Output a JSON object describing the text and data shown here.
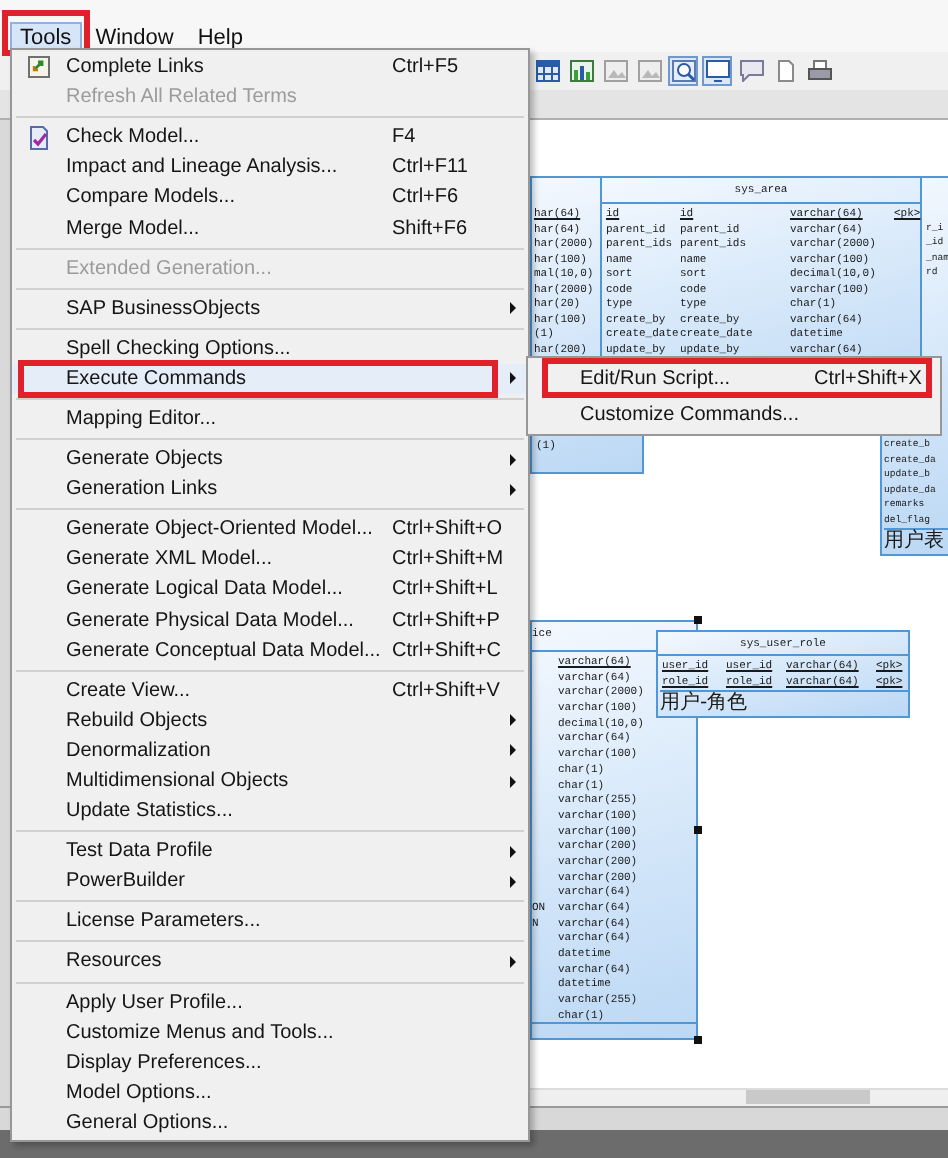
{
  "menu_bar": [
    {
      "label": "Tools",
      "selected": true,
      "outlined": true
    },
    {
      "label": "Window",
      "selected": false,
      "outlined": false
    },
    {
      "label": "Help",
      "selected": false,
      "outlined": false
    }
  ],
  "toolbar": [
    {
      "kind": "table",
      "pressed": false
    },
    {
      "kind": "chart",
      "pressed": false
    },
    {
      "kind": "image",
      "pressed": false
    },
    {
      "kind": "image",
      "pressed": false
    },
    {
      "kind": "zoom",
      "pressed": true
    },
    {
      "kind": "monitor",
      "pressed": true
    },
    {
      "kind": "comment",
      "pressed": false
    },
    {
      "kind": "page",
      "pressed": false
    },
    {
      "kind": "printer",
      "pressed": false
    }
  ],
  "tools_menu": [
    {
      "kind": "links",
      "label": "Complete Links",
      "shortcut": "Ctrl+F5",
      "disabled": false,
      "submenu": false,
      "selected": false,
      "outlined": false
    },
    {
      "kind": "item",
      "label": "Refresh All Related Terms",
      "disabled": true,
      "submenu": false,
      "selected": false,
      "outlined": false
    },
    {
      "kind": "separator"
    },
    {
      "kind": "check",
      "label": "Check Model...",
      "shortcut": "F4",
      "disabled": false,
      "submenu": false,
      "selected": false,
      "outlined": false
    },
    {
      "kind": "item",
      "label": "Impact and Lineage Analysis...",
      "shortcut": "Ctrl+F11",
      "disabled": false,
      "submenu": false,
      "selected": false,
      "outlined": false
    },
    {
      "kind": "item",
      "label": "Compare Models...",
      "shortcut": "Ctrl+F6",
      "disabled": false,
      "submenu": false,
      "selected": false,
      "outlined": false
    },
    {
      "kind": "item",
      "label": "Merge Model...",
      "shortcut": "Shift+F6",
      "disabled": false,
      "submenu": false,
      "selected": false,
      "outlined": false
    },
    {
      "kind": "separator"
    },
    {
      "kind": "item",
      "label": "Extended Generation...",
      "disabled": true,
      "submenu": false,
      "selected": false,
      "outlined": false
    },
    {
      "kind": "separator"
    },
    {
      "kind": "item",
      "label": "SAP BusinessObjects",
      "disabled": false,
      "submenu": true,
      "selected": false,
      "outlined": false
    },
    {
      "kind": "separator"
    },
    {
      "kind": "item",
      "label": "Spell Checking Options...",
      "disabled": false,
      "submenu": false,
      "selected": false,
      "outlined": false
    },
    {
      "kind": "item",
      "label": "Execute Commands",
      "disabled": false,
      "submenu": true,
      "selected": true,
      "outlined": true
    },
    {
      "kind": "separator"
    },
    {
      "kind": "item",
      "label": "Mapping Editor...",
      "disabled": false,
      "submenu": false,
      "selected": false,
      "outlined": false
    },
    {
      "kind": "separator"
    },
    {
      "kind": "item",
      "label": "Generate Objects",
      "disabled": false,
      "submenu": true,
      "selected": false,
      "outlined": false
    },
    {
      "kind": "item",
      "label": "Generation Links",
      "disabled": false,
      "submenu": true,
      "selected": false,
      "outlined": false
    },
    {
      "kind": "separator"
    },
    {
      "kind": "item",
      "label": "Generate Object-Oriented Model...",
      "shortcut": "Ctrl+Shift+O",
      "disabled": false,
      "submenu": false,
      "selected": false,
      "outlined": false
    },
    {
      "kind": "item",
      "label": "Generate XML Model...",
      "shortcut": "Ctrl+Shift+M",
      "disabled": false,
      "submenu": false,
      "selected": false,
      "outlined": false
    },
    {
      "kind": "item",
      "label": "Generate Logical Data Model...",
      "shortcut": "Ctrl+Shift+L",
      "disabled": false,
      "submenu": false,
      "selected": false,
      "outlined": false
    },
    {
      "kind": "item",
      "label": "Generate Physical Data Model...",
      "shortcut": "Ctrl+Shift+P",
      "disabled": false,
      "submenu": false,
      "selected": false,
      "outlined": false
    },
    {
      "kind": "item",
      "label": "Generate Conceptual Data Model...",
      "shortcut": "Ctrl+Shift+C",
      "disabled": false,
      "submenu": false,
      "selected": false,
      "outlined": false
    },
    {
      "kind": "separator"
    },
    {
      "kind": "item",
      "label": "Create View...",
      "shortcut": "Ctrl+Shift+V",
      "disabled": false,
      "submenu": false,
      "selected": false,
      "outlined": false
    },
    {
      "kind": "item",
      "label": "Rebuild Objects",
      "disabled": false,
      "submenu": true,
      "selected": false,
      "outlined": false
    },
    {
      "kind": "item",
      "label": "Denormalization",
      "disabled": false,
      "submenu": true,
      "selected": false,
      "outlined": false
    },
    {
      "kind": "item",
      "label": "Multidimensional Objects",
      "disabled": false,
      "submenu": true,
      "selected": false,
      "outlined": false
    },
    {
      "kind": "item",
      "label": "Update Statistics...",
      "disabled": false,
      "submenu": false,
      "selected": false,
      "outlined": false
    },
    {
      "kind": "separator"
    },
    {
      "kind": "item",
      "label": "Test Data Profile",
      "disabled": false,
      "submenu": true,
      "selected": false,
      "outlined": false
    },
    {
      "kind": "item",
      "label": "PowerBuilder",
      "disabled": false,
      "submenu": true,
      "selected": false,
      "outlined": false
    },
    {
      "kind": "separator"
    },
    {
      "kind": "item",
      "label": "License Parameters...",
      "disabled": false,
      "submenu": false,
      "selected": false,
      "outlined": false
    },
    {
      "kind": "separator"
    },
    {
      "kind": "item",
      "label": "Resources",
      "disabled": false,
      "submenu": true,
      "selected": false,
      "outlined": false
    },
    {
      "kind": "separator"
    },
    {
      "kind": "item",
      "label": "Apply User Profile...",
      "disabled": false,
      "submenu": false,
      "selected": false,
      "outlined": false
    },
    {
      "kind": "item",
      "label": "Customize Menus and Tools...",
      "disabled": false,
      "submenu": false,
      "selected": false,
      "outlined": false
    },
    {
      "kind": "item",
      "label": "Display Preferences...",
      "disabled": false,
      "submenu": false,
      "selected": false,
      "outlined": false
    },
    {
      "kind": "item",
      "label": "Model Options...",
      "disabled": false,
      "submenu": false,
      "selected": false,
      "outlined": false
    },
    {
      "kind": "item",
      "label": "General Options...",
      "disabled": false,
      "submenu": false,
      "selected": false,
      "outlined": false
    }
  ],
  "submenu": [
    {
      "label": "Edit/Run Script...",
      "shortcut": "Ctrl+Shift+X",
      "selected": false,
      "outlined": true
    },
    {
      "label": "Customize Commands...",
      "selected": false,
      "outlined": false
    }
  ],
  "diagram": {
    "tables": [
      {
        "rows": [
          {
            "cells": [
              "har(64)"
            ],
            "primary": true
          },
          {
            "cells": [
              "har(64)"
            ],
            "primary": false
          },
          {
            "cells": [
              "har(2000)"
            ],
            "primary": false
          },
          {
            "cells": [
              "har(100)"
            ],
            "primary": false
          },
          {
            "cells": [
              "mal(10,0)"
            ],
            "primary": false
          },
          {
            "cells": [
              "har(2000)"
            ],
            "primary": false
          },
          {
            "cells": [
              "har(20)"
            ],
            "primary": false
          },
          {
            "cells": [
              "har(100)"
            ],
            "primary": false
          },
          {
            "cells": [
              "(1)"
            ],
            "primary": false
          },
          {
            "cells": [
              "har(200)"
            ],
            "primary": false
          }
        ],
        "rows_after": [
          {
            "cells": [
              "(1)"
            ],
            "primary": false
          }
        ],
        "selected": false
      },
      {
        "name": "sys_area",
        "rows": [
          {
            "cells": [
              "id",
              "id",
              "varchar(64)",
              "<pk>"
            ],
            "primary": true
          },
          {
            "cells": [
              "parent_id",
              "parent_id",
              "varchar(64)"
            ],
            "primary": false
          },
          {
            "cells": [
              "parent_ids",
              "parent_ids",
              "varchar(2000)"
            ],
            "primary": false
          },
          {
            "cells": [
              "name",
              "name",
              "varchar(100)"
            ],
            "primary": false
          },
          {
            "cells": [
              "sort",
              "sort",
              "decimal(10,0)"
            ],
            "primary": false
          },
          {
            "cells": [
              "code",
              "code",
              "varchar(100)"
            ],
            "primary": false
          },
          {
            "cells": [
              "type",
              "type",
              "char(1)"
            ],
            "primary": false
          },
          {
            "cells": [
              "create_by",
              "create_by",
              "varchar(64)"
            ],
            "primary": false
          },
          {
            "cells": [
              "create_date",
              "create_date",
              "datetime"
            ],
            "primary": false
          },
          {
            "cells": [
              "update_by",
              "update_by",
              "varchar(64)"
            ],
            "primary": false
          }
        ],
        "selected": false
      },
      {
        "rows": [
          {
            "cells": [
              "r_i"
            ],
            "primary": false
          },
          {
            "cells": [
              "_id"
            ],
            "primary": false
          },
          {
            "cells": [
              "_nam"
            ],
            "primary": false
          },
          {
            "cells": [
              "rd"
            ],
            "primary": false
          }
        ],
        "rows_after": [
          {
            "cells": [
              "create_b"
            ],
            "primary": false
          },
          {
            "cells": [
              "create_da"
            ],
            "primary": false
          },
          {
            "cells": [
              "update_b"
            ],
            "primary": false
          },
          {
            "cells": [
              "update_da"
            ],
            "primary": false
          },
          {
            "cells": [
              "remarks"
            ],
            "primary": false
          },
          {
            "cells": [
              "del_flag"
            ],
            "primary": false
          }
        ],
        "comment": "用户表",
        "selected": false
      },
      {
        "name": "ice",
        "rows": [
          {
            "cells": [
              "varchar(64)"
            ],
            "primary": true
          },
          {
            "cells": [
              "varchar(64)"
            ],
            "primary": false
          },
          {
            "cells": [
              "varchar(2000)"
            ],
            "primary": false
          },
          {
            "cells": [
              "varchar(100)"
            ],
            "primary": false
          },
          {
            "cells": [
              "decimal(10,0)"
            ],
            "primary": false
          },
          {
            "cells": [
              "varchar(64)"
            ],
            "primary": false
          },
          {
            "cells": [
              "varchar(100)"
            ],
            "primary": false
          },
          {
            "cells": [
              "char(1)"
            ],
            "primary": false
          },
          {
            "cells": [
              "char(1)"
            ],
            "primary": false
          },
          {
            "cells": [
              "varchar(255)"
            ],
            "primary": false
          },
          {
            "cells": [
              "varchar(100)"
            ],
            "primary": false
          },
          {
            "cells": [
              "varchar(100)"
            ],
            "primary": false
          },
          {
            "cells": [
              "varchar(200)"
            ],
            "primary": false
          },
          {
            "cells": [
              "varchar(200)"
            ],
            "primary": false
          },
          {
            "cells": [
              "varchar(200)"
            ],
            "primary": false
          },
          {
            "cells": [
              "varchar(64)"
            ],
            "primary": false
          },
          {
            "cut": "ON",
            "cells": [
              "varchar(64)"
            ],
            "primary": false
          },
          {
            "cut": "N",
            "cells": [
              "varchar(64)"
            ],
            "primary": false
          },
          {
            "cells": [
              "varchar(64)"
            ],
            "primary": false
          },
          {
            "cells": [
              "datetime"
            ],
            "primary": false
          },
          {
            "cells": [
              "varchar(64)"
            ],
            "primary": false
          },
          {
            "cells": [
              "datetime"
            ],
            "primary": false
          },
          {
            "cells": [
              "varchar(255)"
            ],
            "primary": false
          },
          {
            "cells": [
              "char(1)"
            ],
            "primary": false
          }
        ],
        "selected": true
      },
      {
        "name": "sys_user_role",
        "rows": [
          {
            "cells": [
              "user_id",
              "user_id",
              "varchar(64)",
              "<pk>"
            ],
            "primary": true
          },
          {
            "cells": [
              "role_id",
              "role_id",
              "varchar(64)",
              "<pk>"
            ],
            "primary": true
          }
        ],
        "comment": "用户-角色",
        "selected": false
      }
    ]
  }
}
